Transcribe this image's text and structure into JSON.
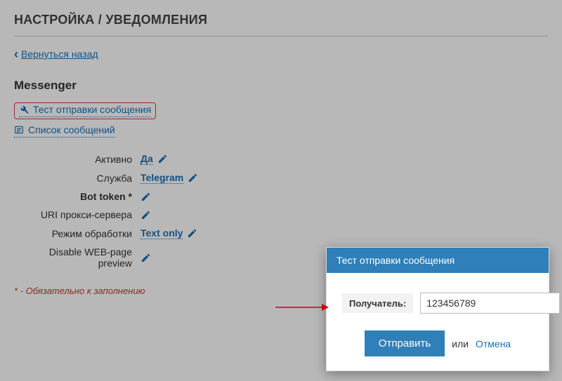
{
  "header": {
    "title": "НАСТРОЙКА / УВЕДОМЛЕНИЯ"
  },
  "back": {
    "label": "Вернуться назад"
  },
  "section": {
    "heading": "Messenger"
  },
  "tools": {
    "test_send": "Тест отправки сообщения",
    "message_list": "Список сообщений"
  },
  "form": {
    "active": {
      "label": "Активно",
      "value": "Да"
    },
    "service": {
      "label": "Служба",
      "value": "Telegram"
    },
    "bot_token": {
      "label": "Bot token *"
    },
    "proxy_uri": {
      "label": "URI прокси-сервера"
    },
    "processing_mode": {
      "label": "Режим обработки",
      "value": "Text only"
    },
    "disable_preview": {
      "label": "Disable WEB-page preview"
    }
  },
  "required_note": "* - Обязательно к заполнению",
  "dialog": {
    "title": "Тест отправки сообщения",
    "recipient_label": "Получатель:",
    "recipient_value": "123456789",
    "submit": "Отправить",
    "or": "или",
    "cancel": "Отмена"
  }
}
